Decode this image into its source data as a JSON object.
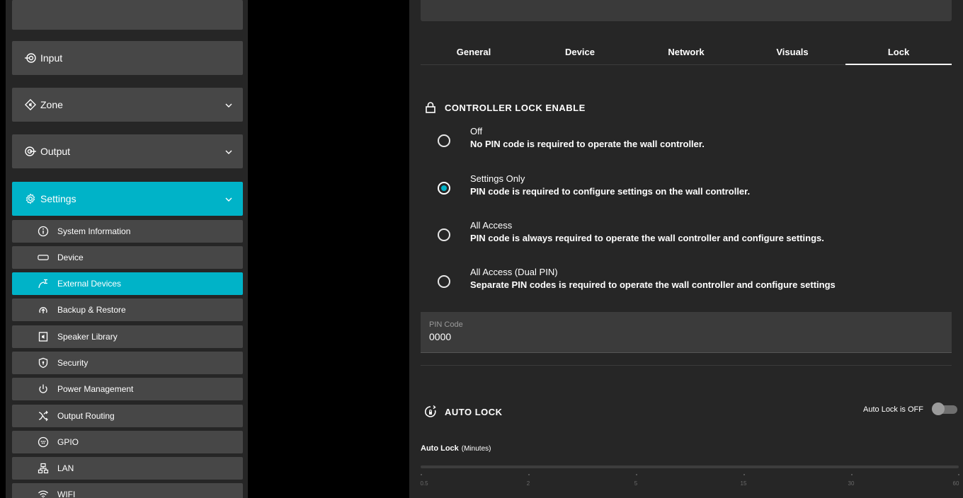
{
  "sidebar": {
    "groups": [
      {
        "label": "Input",
        "icon": "input-icon",
        "expandable": false
      },
      {
        "label": "Zone",
        "icon": "zone-icon",
        "expandable": true
      },
      {
        "label": "Output",
        "icon": "output-icon",
        "expandable": true
      },
      {
        "label": "Settings",
        "icon": "settings-icon",
        "expandable": true,
        "active": true
      }
    ],
    "settings_items": [
      {
        "label": "System Information",
        "icon": "info-icon"
      },
      {
        "label": "Device",
        "icon": "device-icon"
      },
      {
        "label": "External Devices",
        "icon": "external-devices-icon",
        "active": true
      },
      {
        "label": "Backup & Restore",
        "icon": "backup-icon"
      },
      {
        "label": "Speaker Library",
        "icon": "speaker-library-icon"
      },
      {
        "label": "Security",
        "icon": "security-icon"
      },
      {
        "label": "Power Management",
        "icon": "power-icon"
      },
      {
        "label": "Output Routing",
        "icon": "routing-icon"
      },
      {
        "label": "GPIO",
        "icon": "gpio-icon"
      },
      {
        "label": "LAN",
        "icon": "lan-icon"
      },
      {
        "label": "WIFI",
        "icon": "wifi-icon"
      }
    ]
  },
  "tabs": [
    {
      "label": "General"
    },
    {
      "label": "Device"
    },
    {
      "label": "Network"
    },
    {
      "label": "Visuals"
    },
    {
      "label": "Lock",
      "active": true
    }
  ],
  "controller_lock": {
    "title": "CONTROLLER LOCK ENABLE",
    "options": [
      {
        "title": "Off",
        "desc": "No PIN code is required to operate the wall controller.",
        "selected": false
      },
      {
        "title": "Settings Only",
        "desc": "PIN code is required to configure settings on the wall controller.",
        "selected": true
      },
      {
        "title": "All Access",
        "desc": "PIN code is always required to operate the wall controller and configure settings.",
        "selected": false
      },
      {
        "title": "All Access (Dual PIN)",
        "desc": "Separate PIN codes is required to operate the wall controller and configure settings",
        "selected": false
      }
    ]
  },
  "pin": {
    "label": "PIN Code",
    "value": "0000"
  },
  "auto_lock": {
    "title": "AUTO LOCK",
    "status": "Auto Lock is OFF",
    "enabled": false,
    "slider_label": "Auto Lock",
    "slider_unit": "(Minutes)",
    "ticks": [
      "0.5",
      "2",
      "5",
      "15",
      "30",
      "60"
    ]
  },
  "colors": {
    "accent": "#00b3c8",
    "panel": "#262626",
    "item": "#474747"
  }
}
